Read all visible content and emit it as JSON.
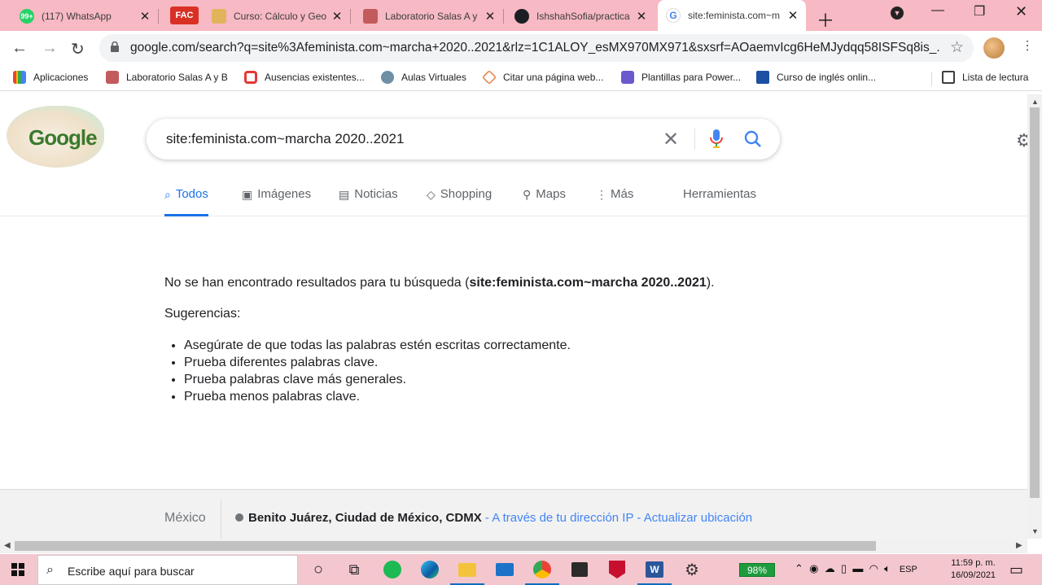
{
  "browser": {
    "tabs": [
      {
        "title": "(117) WhatsApp",
        "favicon": "whatsapp-icon",
        "badge": "99+"
      },
      {
        "title": "Curso: Cálculo y Geo",
        "favicon": "course-icon",
        "badge": "FAC"
      },
      {
        "title": "Laboratorio Salas A y",
        "favicon": "lab-icon"
      },
      {
        "title": "IshshahSofia/practica",
        "favicon": "github-icon"
      },
      {
        "title": "site:feminista.com~m",
        "favicon": "google-icon",
        "active": true
      }
    ],
    "url": "google.com/search?q=site%3Afeminista.com~marcha+2020..2021&rlz=1C1ALOY_esMX970MX971&sxsrf=AOaemvIcg6HeMJydqq58ISFSq8is_...",
    "bookmarks": [
      "Aplicaciones",
      "Laboratorio Salas A y B",
      "Ausencias existentes...",
      "Aulas Virtuales",
      "Citar una página web...",
      "Plantillas para Power...",
      "Curso de inglés onlin...",
      "Lista de lectura"
    ]
  },
  "search": {
    "logo_text": "Google",
    "query": "site:feminista.com~marcha 2020..2021",
    "tabs": [
      "Todos",
      "Imágenes",
      "Noticias",
      "Shopping",
      "Maps",
      "Más",
      "Herramientas"
    ],
    "no_results_prefix": "No se han encontrado resultados para tu búsqueda (",
    "no_results_query": "site:feminista.com~marcha 2020..2021",
    "no_results_suffix": ").",
    "suggestions_title": "Sugerencias:",
    "suggestions": [
      "Asegúrate de que todas las palabras estén escritas correctamente.",
      "Prueba diferentes palabras clave.",
      "Prueba palabras clave más generales.",
      "Prueba menos palabras clave."
    ]
  },
  "footer": {
    "country": "México",
    "location": "Benito Juárez, Ciudad de México, CDMX",
    "via": " - A través de tu dirección IP",
    "update": " - Actualizar ubicación"
  },
  "taskbar": {
    "search_placeholder": "Escribe aquí para buscar",
    "battery": "98%",
    "lang": "ESP",
    "time": "11:59 p. m.",
    "date": "16/09/2021"
  },
  "colors": {
    "accent": "#1a73e8",
    "tabstrip": "#f7b9c3",
    "taskbar": "#f4c7cf"
  }
}
